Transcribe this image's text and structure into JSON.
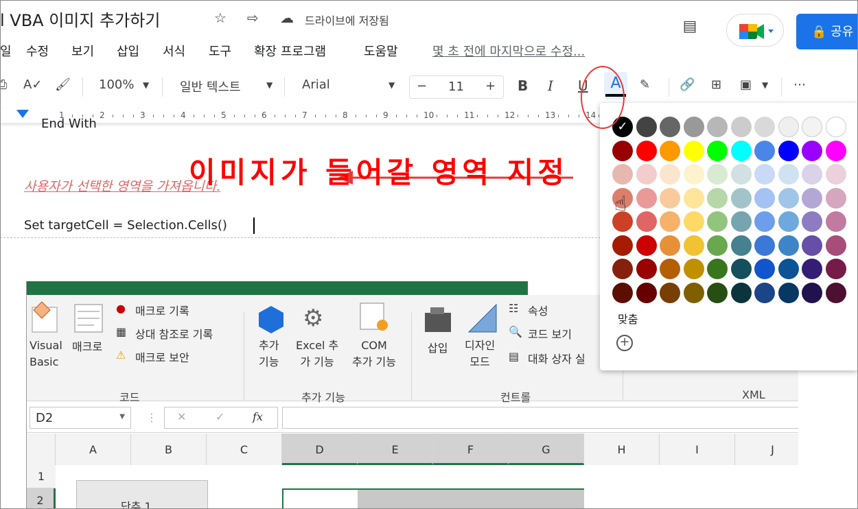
{
  "doc": {
    "title": "l VBA 이미지 추가하기",
    "drive_status": "드라이브에 저장됨",
    "last_edit": "몇 초 전에 마지막으로 수정...",
    "share_label": "공유",
    "menu": [
      "일",
      "수정",
      "보기",
      "삽입",
      "서식",
      "도구",
      "확장 프로그램",
      "도움말"
    ]
  },
  "toolbar": {
    "zoom": "100%",
    "style": "일반 텍스트",
    "font": "Arial",
    "font_size": "11",
    "minus": "−",
    "plus": "+",
    "bold": "B",
    "italic": "I",
    "underline": "U",
    "text_color": "A",
    "more": "⋯"
  },
  "ruler": {
    "numbers": [
      "1",
      "2",
      "3",
      "4",
      "5",
      "6",
      "7",
      "8",
      "9",
      "10",
      "11",
      "12",
      "13",
      "14"
    ]
  },
  "content": {
    "end_with": "End With",
    "comment": "사용자가 선택한 영역을 가져옵니다.",
    "code": "Set targetCell = Selection.Cells()"
  },
  "excel": {
    "visual_basic": "Visual\nBasic",
    "macro": "매크로",
    "record_macro": "매크로 기록",
    "relative_ref": "상대 참조로 기록",
    "macro_security": "매크로 보안",
    "group_code": "코드",
    "addins": "추가\n기능",
    "excel_addins": "Excel 추\n가 기능",
    "com_addins": "COM\n추가 기능",
    "group_addins": "추가 기능",
    "insert": "삽입",
    "design_mode": "디자인\n모드",
    "properties": "속성",
    "view_code": "코드 보기",
    "run_dialog": "대화 상자 실",
    "group_controls": "컨트롤",
    "group_xml": "XML",
    "namebox": "D2",
    "fx": "fx",
    "columns": [
      "A",
      "B",
      "C",
      "D",
      "E",
      "F",
      "G",
      "H",
      "I",
      "J"
    ],
    "rows": [
      "1",
      "2"
    ],
    "cell_text": "단추 1",
    "overlay_label": "이미지가 들어갈 영역 지정"
  },
  "palette": {
    "fit_label": "맞춤",
    "add_label": "+",
    "colors": [
      [
        "#000000",
        "#434343",
        "#666666",
        "#999999",
        "#b7b7b7",
        "#cccccc",
        "#d9d9d9",
        "#efefef",
        "#f3f3f3",
        "#ffffff"
      ],
      [
        "#980000",
        "#ff0000",
        "#ff9900",
        "#ffff00",
        "#00ff00",
        "#00ffff",
        "#4a86e8",
        "#0000ff",
        "#9900ff",
        "#ff00ff"
      ],
      [
        "#e6b8af",
        "#f4cccc",
        "#fce5cd",
        "#fff2cc",
        "#d9ead3",
        "#d0e0e3",
        "#c9daf8",
        "#cfe2f3",
        "#d9d2e9",
        "#ead1dc"
      ],
      [
        "#dd7e6b",
        "#ea9999",
        "#f9cb9c",
        "#ffe599",
        "#b6d7a8",
        "#a2c4c9",
        "#a4c2f4",
        "#9fc5e8",
        "#b4a7d6",
        "#d5a6bd"
      ],
      [
        "#cc4125",
        "#e06666",
        "#f6b26b",
        "#ffd966",
        "#93c47d",
        "#76a5af",
        "#6d9eeb",
        "#6fa8dc",
        "#8e7cc3",
        "#c27ba0"
      ],
      [
        "#a61c00",
        "#cc0000",
        "#e69138",
        "#f1c232",
        "#6aa84f",
        "#45818e",
        "#3c78d8",
        "#3d85c6",
        "#674ea7",
        "#a64d79"
      ],
      [
        "#85200c",
        "#990000",
        "#b45f06",
        "#bf9000",
        "#38761d",
        "#134f5c",
        "#1155cc",
        "#0b5394",
        "#351c75",
        "#741b47"
      ],
      [
        "#5b0f00",
        "#660000",
        "#783f04",
        "#7f6000",
        "#274e13",
        "#0c343d",
        "#1c4587",
        "#073763",
        "#20124d",
        "#4c1130"
      ]
    ]
  }
}
